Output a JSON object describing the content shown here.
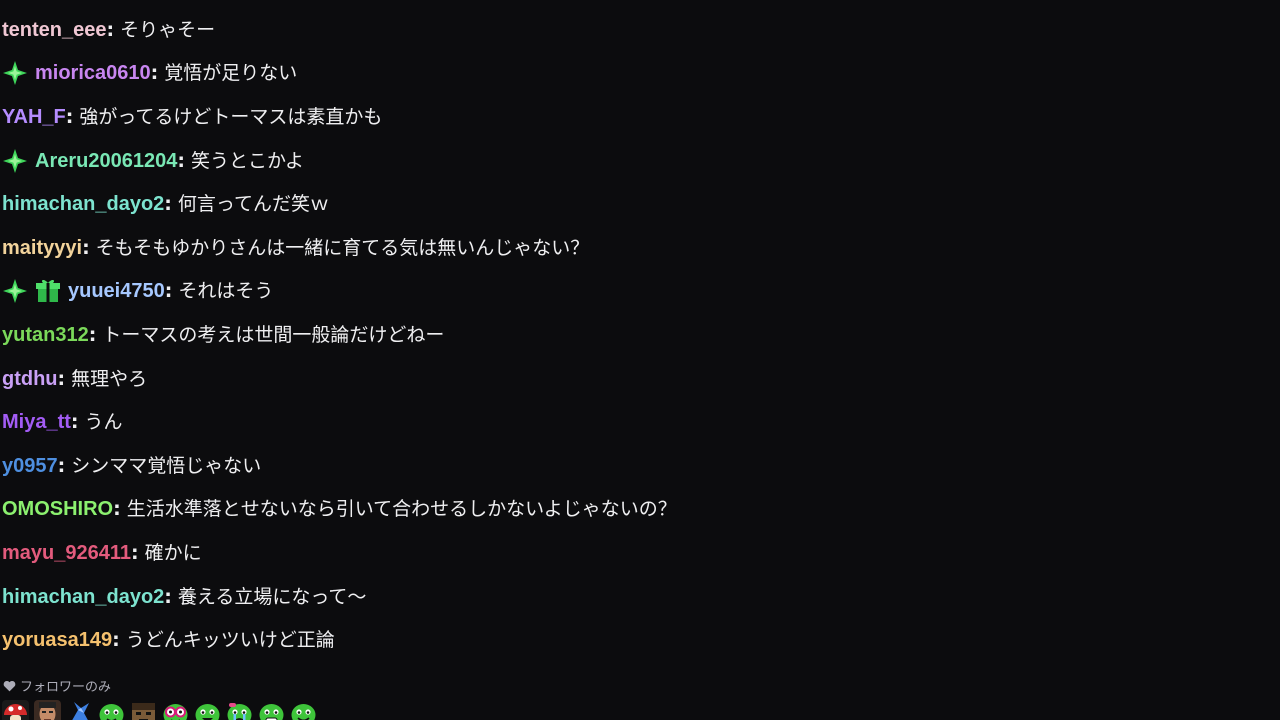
{
  "colors": {
    "background": "#0c0c0e",
    "message_text": "#efeff1",
    "muted": "#adadb8"
  },
  "messages": [
    {
      "user": "tenten_eee",
      "text": "そりゃそー",
      "color": "#f0c7d3",
      "badges": []
    },
    {
      "user": "miorica0610",
      "text": "覚悟が足りない",
      "color": "#c886f0",
      "badges": [
        "sparkle-badge-icon"
      ]
    },
    {
      "user": "YAH_F",
      "text": "強がってるけどトーマスは素直かも",
      "color": "#b58cff",
      "badges": []
    },
    {
      "user": "Areru20061204",
      "text": "笑うとこかよ",
      "color": "#79e7b4",
      "badges": [
        "sparkle-badge-icon"
      ]
    },
    {
      "user": "himachan_dayo2",
      "text": "何言ってんだ笑ｗ",
      "color": "#7de3cf",
      "badges": []
    },
    {
      "user": "maityyyi",
      "text": "そもそもゆかりさんは一緒に育てる気は無いんじゃない？",
      "color": "#f2d39b",
      "badges": []
    },
    {
      "user": "yuuei4750",
      "text": "それはそう",
      "color": "#a6c8ff",
      "badges": [
        "sparkle-badge-icon",
        "gift-badge-icon"
      ]
    },
    {
      "user": "yutan312",
      "text": "トーマスの考えは世間一般論だけどねー",
      "color": "#7bd95a",
      "badges": []
    },
    {
      "user": "gtdhu",
      "text": "無理やろ",
      "color": "#c9a0f5",
      "badges": []
    },
    {
      "user": "Miya_tt",
      "text": "うん",
      "color": "#a35cf5",
      "badges": []
    },
    {
      "user": "y0957",
      "text": "シンママ覚悟じゃない",
      "color": "#4e8fe0",
      "badges": []
    },
    {
      "user": "OMOSHIRO",
      "text": "生活水準落とせないなら引いて合わせるしかないよじゃないの？",
      "color": "#8cf06f",
      "badges": []
    },
    {
      "user": "mayu_926411",
      "text": "確かに",
      "color": "#e35b7d",
      "badges": []
    },
    {
      "user": "himachan_dayo2",
      "text": "養える立場になって〜",
      "color": "#7de3cf",
      "badges": []
    },
    {
      "user": "yoruasa149",
      "text": "うどんキッツいけど正論",
      "color": "#f5c16e",
      "badges": []
    }
  ],
  "footer": {
    "notice": "フォロワーのみ",
    "notice_icon": "heart-icon",
    "emotes": [
      "red-mushroom-emote",
      "face-photo-emote",
      "blue-bird-emote",
      "green-blob-emote",
      "brown-face-emote",
      "glasses-blob-emote",
      "green-smile-emote",
      "green-cry-emote",
      "green-grin-emote",
      "green-wave-emote"
    ]
  }
}
